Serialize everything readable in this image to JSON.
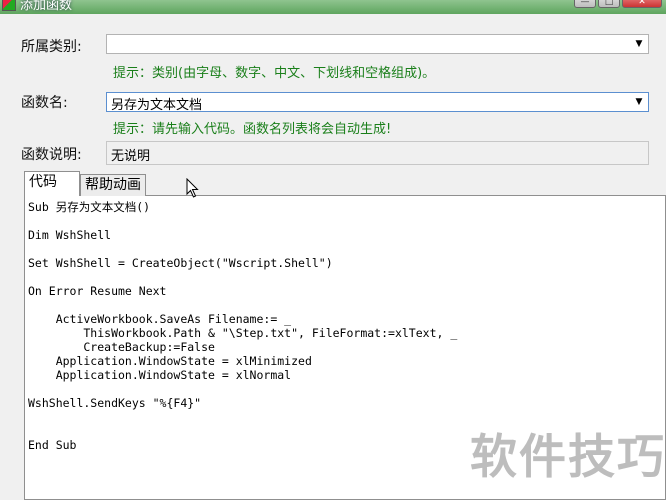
{
  "window": {
    "title": "添加函数",
    "minimize_glyph": "—",
    "maximize_glyph": "□",
    "close_glyph": "✕"
  },
  "form": {
    "category": {
      "label": "所属类别:",
      "value": "",
      "hint": "提示：类别(由字母、数字、中文、下划线和空格组成)。"
    },
    "function_name": {
      "label": "函数名:",
      "value": "另存为文本文档",
      "hint": "提示：请先输入代码。函数名列表将会自动生成!"
    },
    "description": {
      "label": "函数说明:",
      "value": "无说明"
    }
  },
  "tabs": [
    {
      "label": "代码",
      "active": true
    },
    {
      "label": "帮助动画",
      "active": false
    }
  ],
  "code": {
    "text": "Sub 另存为文本文档()\n\nDim WshShell\n\nSet WshShell = CreateObject(\"Wscript.Shell\")\n\nOn Error Resume Next\n\n    ActiveWorkbook.SaveAs Filename:= _\n        ThisWorkbook.Path & \"\\Step.txt\", FileFormat:=xlText, _\n        CreateBackup:=False\n    Application.WindowState = xlMinimized\n    Application.WindowState = xlNormal\n\nWshShell.SendKeys \"%{F4}\"\n\n\nEnd Sub"
  },
  "watermark": "软件技巧",
  "icons": {
    "dropdown": "chevron-down-icon",
    "cursor": "mouse-pointer-icon",
    "app": "app-icon"
  }
}
